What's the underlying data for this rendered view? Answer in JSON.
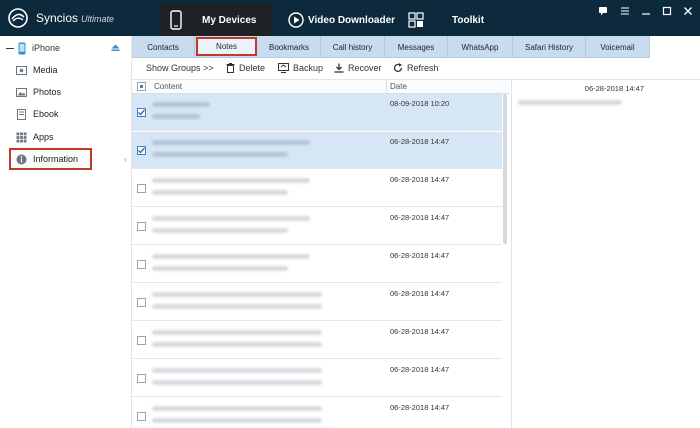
{
  "app": {
    "name": "Syncios",
    "edition": "Ultimate"
  },
  "nav": {
    "my_devices": "My Devices",
    "video_downloader": "Video Downloader",
    "toolkit": "Toolkit"
  },
  "window_controls": [
    "chat-icon",
    "menu-icon",
    "minimize-icon",
    "maximize-icon",
    "close-icon"
  ],
  "device": {
    "name": "iPhone"
  },
  "sidebar": {
    "items": [
      {
        "label": "Media",
        "icon": "media-icon"
      },
      {
        "label": "Photos",
        "icon": "photos-icon"
      },
      {
        "label": "Ebook",
        "icon": "ebook-icon"
      },
      {
        "label": "Apps",
        "icon": "apps-icon"
      },
      {
        "label": "Information",
        "icon": "info-icon"
      }
    ]
  },
  "tabs": [
    "Contacts",
    "Notes",
    "Bookmarks",
    "Call history",
    "Messages",
    "WhatsApp",
    "Safari History",
    "Voicemail"
  ],
  "active_tab": "Notes",
  "toolbar": {
    "show_groups": "Show Groups >>",
    "delete": "Delete",
    "backup": "Backup",
    "recover": "Recover",
    "refresh": "Refresh"
  },
  "table": {
    "col_content": "Content",
    "col_date": "Date",
    "rows": [
      {
        "date": "08-09-2018 10:20",
        "checked": true
      },
      {
        "date": "06-28-2018 14:47",
        "checked": true
      },
      {
        "date": "06-28-2018 14:47",
        "checked": false
      },
      {
        "date": "06-28-2018 14:47",
        "checked": false
      },
      {
        "date": "06-28-2018 14:47",
        "checked": false
      },
      {
        "date": "06-28-2018 14:47",
        "checked": false
      },
      {
        "date": "06-28-2018 14:47",
        "checked": false
      },
      {
        "date": "06-28-2018 14:47",
        "checked": false
      },
      {
        "date": "06-28-2018 14:47",
        "checked": false
      }
    ]
  },
  "detail": {
    "date": "06-28-2018 14:47"
  },
  "colors": {
    "titlebar": "#0d2a3d",
    "tabs": "#c9dcef",
    "selected_row": "#d6e6f5",
    "highlight": "#c0392b"
  }
}
